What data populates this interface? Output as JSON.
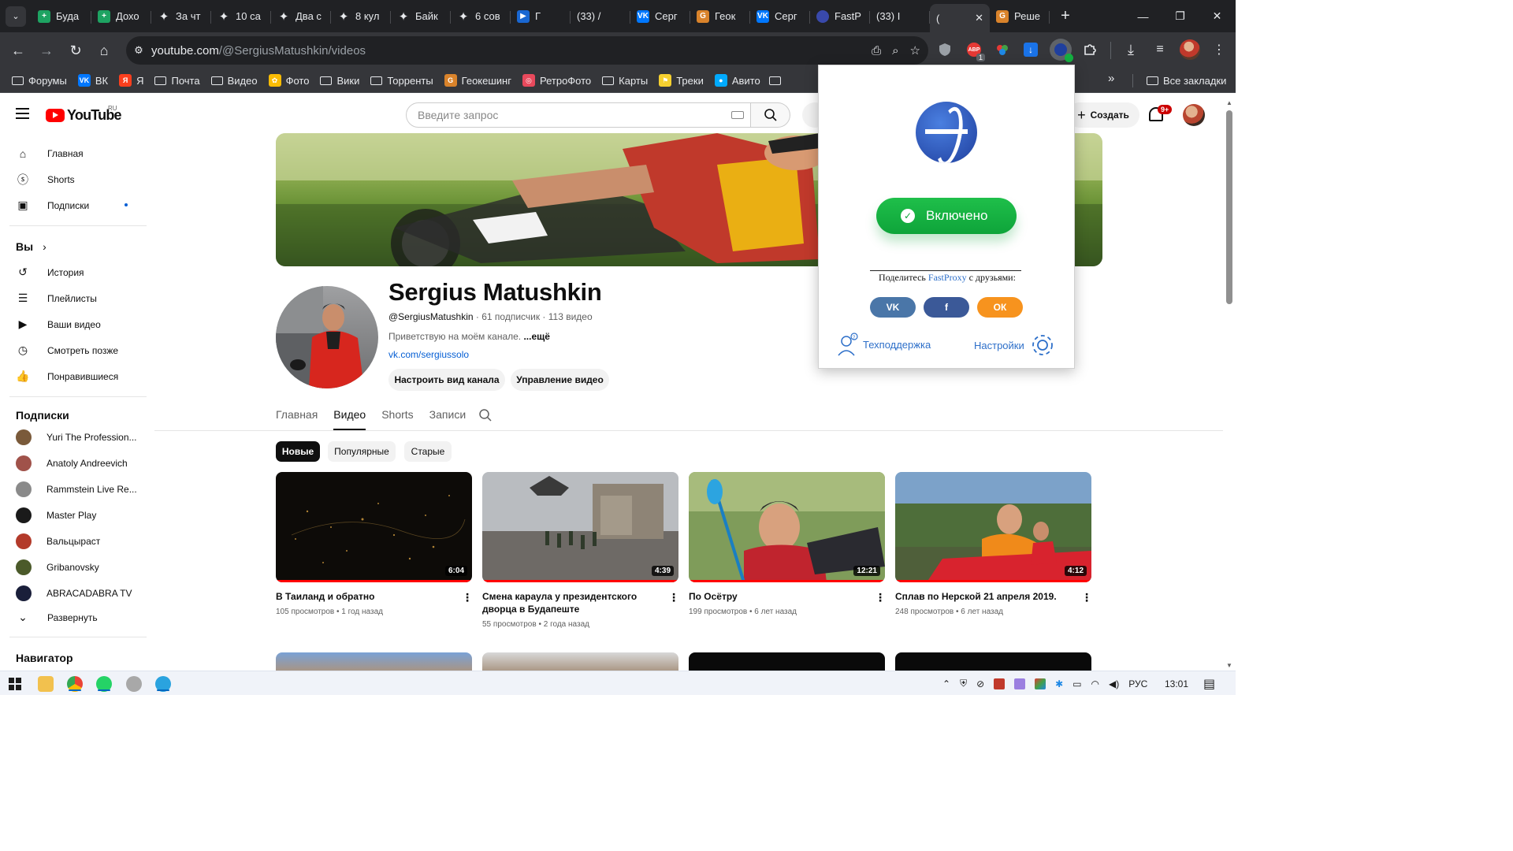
{
  "browser": {
    "tabs": [
      {
        "label": "Буда",
        "icon": "sheets"
      },
      {
        "label": "Дохо",
        "icon": "sheets"
      },
      {
        "label": "За чт",
        "icon": "spark"
      },
      {
        "label": "10 са",
        "icon": "spark"
      },
      {
        "label": "Два с",
        "icon": "spark"
      },
      {
        "label": "8 кул",
        "icon": "spark"
      },
      {
        "label": "Байк",
        "icon": "spark"
      },
      {
        "label": "6 сов",
        "icon": "spark"
      },
      {
        "label": "Г",
        "icon": "play"
      },
      {
        "label": "(33) /",
        "icon": "yt"
      },
      {
        "label": "Серг",
        "icon": "vk"
      },
      {
        "label": "Геок",
        "icon": "geo"
      },
      {
        "label": "Серг",
        "icon": "vk"
      },
      {
        "label": "FastP",
        "icon": "globe"
      },
      {
        "label": "(33) I",
        "icon": "yt"
      },
      {
        "label": "(",
        "icon": "yt"
      },
      {
        "label": "Реше",
        "icon": "geo"
      }
    ],
    "url_host": "youtube.com",
    "url_path": "/@SergiusMatushkin/videos",
    "bookmarks": [
      {
        "label": "Форумы",
        "icon": "folder"
      },
      {
        "label": "ВК",
        "icon": "vk"
      },
      {
        "label": "Я",
        "icon": "yandex"
      },
      {
        "label": "Почта",
        "icon": "folder"
      },
      {
        "label": "Видео",
        "icon": "folder"
      },
      {
        "label": "Фото",
        "icon": "photos"
      },
      {
        "label": "Вики",
        "icon": "folder"
      },
      {
        "label": "Торренты",
        "icon": "folder"
      },
      {
        "label": "Геокешинг",
        "icon": "geo"
      },
      {
        "label": "РетроФото",
        "icon": "retro"
      },
      {
        "label": "Карты",
        "icon": "folder"
      },
      {
        "label": "Треки",
        "icon": "tracks"
      },
      {
        "label": "Авито",
        "icon": "avito"
      }
    ],
    "all_bookmarks": "Все закладки",
    "ext_badge": "1"
  },
  "youtube": {
    "logo_text": "YouTube",
    "logo_region": "RU",
    "search_placeholder": "Введите запрос",
    "create_label": "Создать",
    "notif_badge": "9+",
    "sidebar": {
      "main": [
        {
          "label": "Главная",
          "icon": "home-icon"
        },
        {
          "label": "Shorts",
          "icon": "shorts-icon"
        },
        {
          "label": "Подписки",
          "icon": "subscriptions-icon"
        }
      ],
      "you_header": "Вы",
      "you": [
        {
          "label": "История",
          "icon": "history-icon"
        },
        {
          "label": "Плейлисты",
          "icon": "playlists-icon"
        },
        {
          "label": "Ваши видео",
          "icon": "your-videos-icon"
        },
        {
          "label": "Смотреть позже",
          "icon": "watch-later-icon"
        },
        {
          "label": "Понравившиеся",
          "icon": "liked-icon"
        }
      ],
      "subs_header": "Подписки",
      "subs": [
        {
          "label": "Yuri The Profession...",
          "color": "#7a5a3a"
        },
        {
          "label": "Anatoly Andreevich",
          "color": "#a0524a"
        },
        {
          "label": "Rammstein Live Re...",
          "color": "#8a8a8a"
        },
        {
          "label": "Master Play",
          "color": "#1a1a1a"
        },
        {
          "label": "Вальцыраст",
          "color": "#b33a2a"
        },
        {
          "label": "Gribanovsky",
          "color": "#4b5a2a"
        },
        {
          "label": "ABRACADABRA TV",
          "color": "#1a1f3a"
        }
      ],
      "expand_label": "Развернуть",
      "navigator_header": "Навигатор"
    },
    "channel": {
      "name": "Sergius Matushkin",
      "handle": "@SergiusMatushkin",
      "stats": " · 61 подписчик · 113 видео",
      "description": "Приветствую на моём канале. ",
      "more": "...ещё",
      "link": "vk.com/sergiussolo",
      "customize_button": "Настроить вид канала",
      "manage_button": "Управление видео",
      "tabs": [
        "Главная",
        "Видео",
        "Shorts",
        "Записи"
      ],
      "active_tab": 1,
      "chips": [
        "Новые",
        "Популярные",
        "Старые"
      ]
    },
    "videos": [
      {
        "title": "В Таиланд и обратно",
        "stats": "105 просмотров • 1 год назад",
        "duration": "6:04"
      },
      {
        "title": "Смена караула у президентского дворца в Будапеште",
        "stats": "55 просмотров • 2 года назад",
        "duration": "4:39"
      },
      {
        "title": "По Осётру",
        "stats": "199 просмотров • 6 лет назад",
        "duration": "12:21"
      },
      {
        "title": "Сплав по Нерской 21 апреля 2019.",
        "stats": "248 просмотров • 6 лет назад",
        "duration": "4:12"
      }
    ]
  },
  "fastproxy": {
    "toggle_label": "Включено",
    "share_prefix": "Поделитесь ",
    "share_brand": "FastProxy",
    "share_suffix": " с друзьями:",
    "support_label": "Техподдержка",
    "settings_label": "Настройки",
    "social": [
      {
        "name": "vk",
        "glyph": "VK",
        "color": "#4a76a8"
      },
      {
        "name": "facebook",
        "glyph": "f",
        "color": "#3b5998"
      },
      {
        "name": "odnoklassniki",
        "glyph": "ОК",
        "color": "#f7931e"
      }
    ],
    "toggle_color": "#14b041"
  },
  "taskbar": {
    "language": "РУС",
    "time": "13:01"
  }
}
